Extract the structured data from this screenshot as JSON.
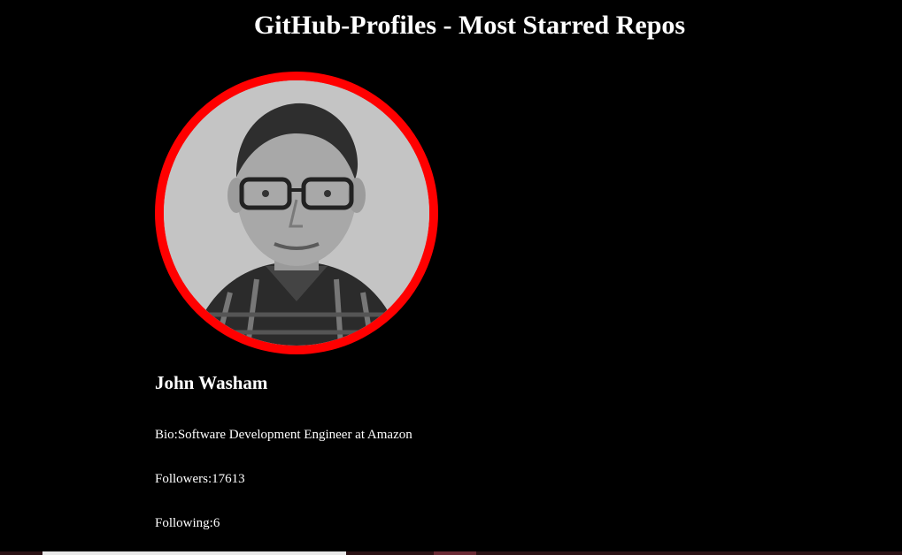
{
  "header": {
    "title": "GitHub-Profiles - Most Starred Repos"
  },
  "profile": {
    "avatar_icon": "avatar-photo",
    "ring_color": "#ff0000",
    "name": "John Washam",
    "bio": "Bio:Software Development Engineer at Amazon",
    "followers": "Followers:17613",
    "following": "Following:6"
  }
}
